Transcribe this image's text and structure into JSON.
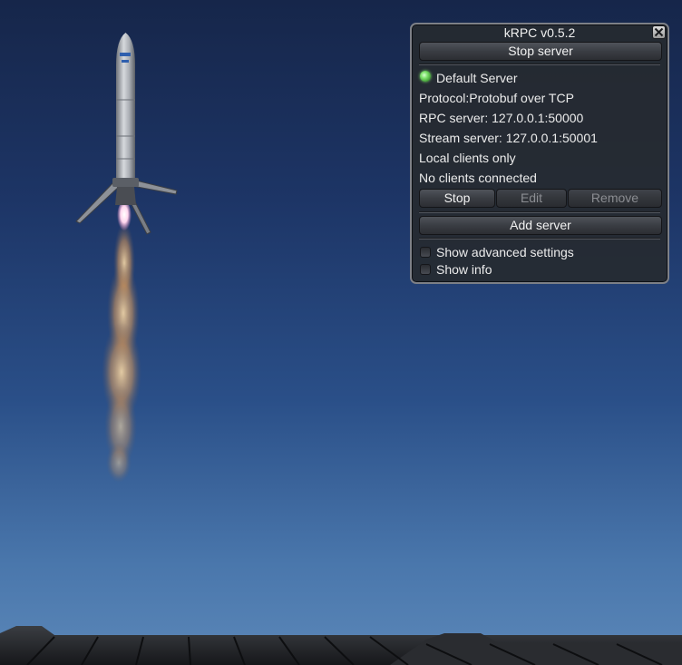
{
  "window": {
    "title": "kRPC v0.5.2",
    "close_icon": "close-icon",
    "stop_server_label": "Stop server",
    "server": {
      "status": "running",
      "status_color": "#7de06b",
      "name": "Default Server",
      "protocol": "Protocol:Protobuf over TCP",
      "rpc_server": "RPC server: 127.0.0.1:50000",
      "stream_server": "Stream server: 127.0.0.1:50001",
      "clients_scope": "Local clients only",
      "clients_status": "No clients connected"
    },
    "server_actions": {
      "stop_label": "Stop",
      "edit_label": "Edit",
      "remove_label": "Remove"
    },
    "add_server_label": "Add server",
    "options": [
      {
        "label": "Show advanced settings",
        "checked": false
      },
      {
        "label": "Show info",
        "checked": false
      }
    ]
  }
}
